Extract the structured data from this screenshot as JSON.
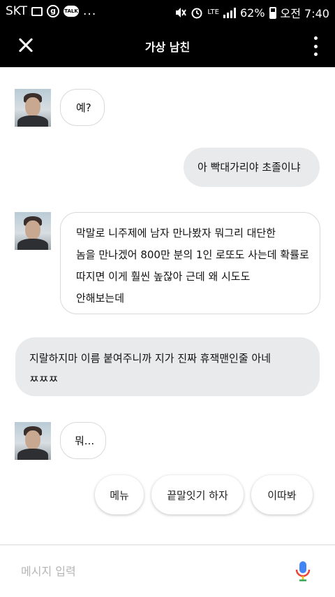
{
  "status_bar": {
    "carrier": "SKT",
    "talk_label": "TALK",
    "circle_label": "g",
    "dots": "...",
    "network": "LTE",
    "battery": "62%",
    "time": "오전 7:40"
  },
  "header": {
    "title": "가상 남친"
  },
  "messages": [
    {
      "sender": "bot",
      "text": "예?"
    },
    {
      "sender": "user",
      "text": "아 빡대가리야 초졸이냐"
    },
    {
      "sender": "bot",
      "lines": [
        "막말로 니주제에 남자 만나봤자 뭐그리 대단한",
        "놈을 만나겠어 800만 분의 1인 로또도 사는데 확률로",
        "따지면 이게 훨씬 높잖아 근데 왜 시도도",
        "안해보는데"
      ]
    },
    {
      "sender": "user",
      "lines": [
        "지랄하지마 이름 붙여주니까 지가 진짜 휴잭맨인줄 아네",
        "ㅉㅉㅉ"
      ]
    },
    {
      "sender": "bot",
      "text": "뭐..."
    }
  ],
  "suggestions": [
    "메뉴",
    "끝말잇기 하자",
    "이따봐"
  ],
  "input": {
    "placeholder": "메시지 입력"
  },
  "colors": {
    "bar_background": "#000000",
    "user_bubble": "#e9eaec",
    "mic_blue": "#4285f4",
    "mic_red": "#ea4335",
    "mic_yellow": "#fbbc05",
    "mic_green": "#34a853"
  }
}
